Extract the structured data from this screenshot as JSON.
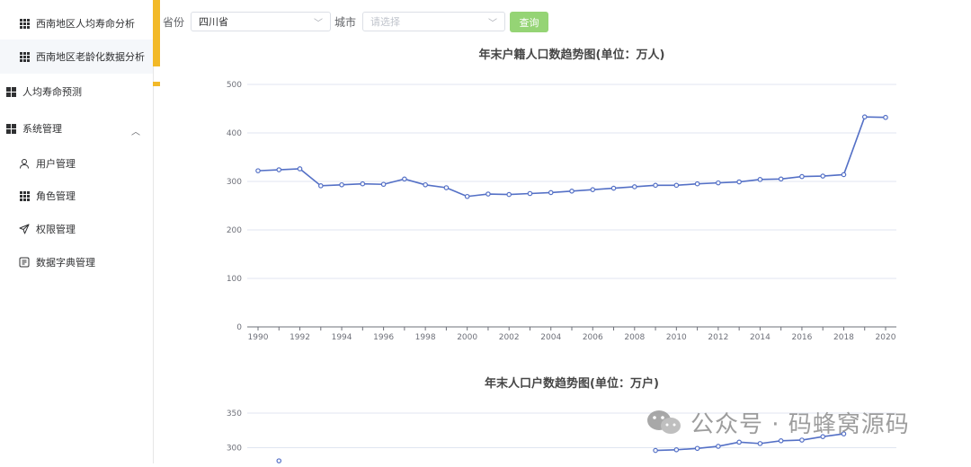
{
  "sidebar": {
    "items": [
      {
        "label": "西南地区人均寿命分析",
        "icon": "grid-icon"
      },
      {
        "label": "西南地区老龄化数据分析",
        "icon": "grid-icon"
      },
      {
        "label": "人均寿命预测",
        "icon": "grid4-icon"
      },
      {
        "label": "系统管理",
        "icon": "grid4-icon",
        "expanded": true
      },
      {
        "label": "用户管理",
        "icon": "user-icon"
      },
      {
        "label": "角色管理",
        "icon": "grid-icon"
      },
      {
        "label": "权限管理",
        "icon": "send-icon"
      },
      {
        "label": "数据字典管理",
        "icon": "dictionary-icon"
      }
    ]
  },
  "toolbar": {
    "province_label": "省份",
    "province_value": "四川省",
    "city_label": "城市",
    "city_placeholder": "请选择",
    "query_label": "查询"
  },
  "colors": {
    "accent": "#f2b928",
    "series": "#5470c6",
    "button": "#95d475"
  },
  "watermark": "公众号 · 码蜂窝源码",
  "chart_data": [
    {
      "type": "line",
      "title": "年末户籍人口数趋势图(单位：万人)",
      "x": [
        1990,
        1991,
        1992,
        1993,
        1994,
        1995,
        1996,
        1997,
        1998,
        1999,
        2000,
        2001,
        2002,
        2003,
        2004,
        2005,
        2006,
        2007,
        2008,
        2009,
        2010,
        2011,
        2012,
        2013,
        2014,
        2015,
        2016,
        2017,
        2018,
        2019,
        2020
      ],
      "xticks": [
        "1990",
        "1992",
        "1994",
        "1996",
        "1998",
        "2000",
        "2002",
        "2004",
        "2006",
        "2008",
        "2010",
        "2012",
        "2014",
        "2016",
        "2018",
        "2020"
      ],
      "values": [
        322,
        324,
        326,
        291,
        293,
        295,
        294,
        305,
        293,
        287,
        269,
        274,
        273,
        275,
        277,
        280,
        283,
        286,
        289,
        292,
        292,
        295,
        297,
        299,
        304,
        305,
        310,
        311,
        314,
        433,
        432
      ],
      "ylim": [
        0,
        500
      ],
      "yticks": [
        0,
        100,
        200,
        300,
        400,
        500
      ]
    },
    {
      "type": "line",
      "title": "年末人口户数趋势图(单位：万户)",
      "yticks": [
        300,
        350
      ],
      "points": [
        {
          "x": 1991,
          "y": 281
        },
        {
          "x": 2009,
          "y": 296
        },
        {
          "x": 2010,
          "y": 297
        },
        {
          "x": 2011,
          "y": 299
        },
        {
          "x": 2012,
          "y": 302
        },
        {
          "x": 2013,
          "y": 308
        },
        {
          "x": 2014,
          "y": 306
        },
        {
          "x": 2015,
          "y": 310
        },
        {
          "x": 2016,
          "y": 311
        },
        {
          "x": 2017,
          "y": 316
        },
        {
          "x": 2018,
          "y": 320
        }
      ]
    }
  ]
}
